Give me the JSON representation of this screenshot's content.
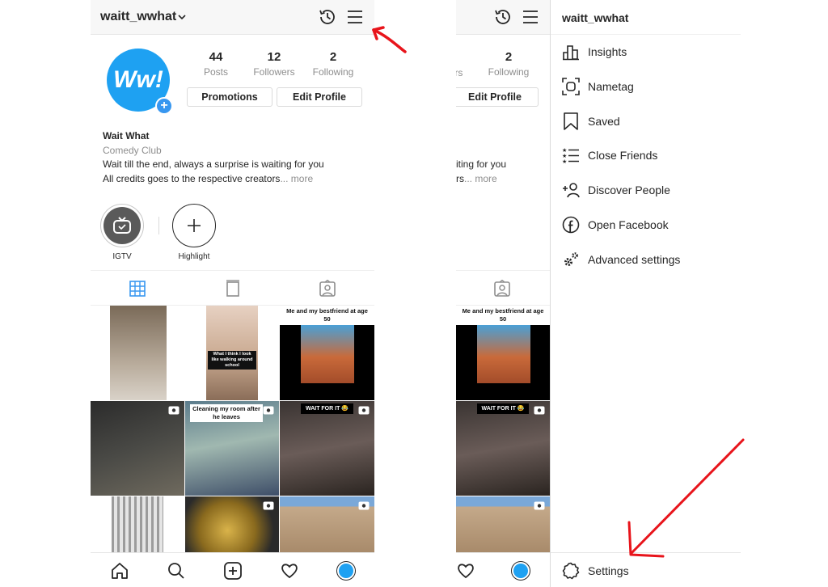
{
  "profile": {
    "username": "waitt_wwhat",
    "avatar_text": "Ww!",
    "stats": [
      {
        "num": "44",
        "label": "Posts"
      },
      {
        "num": "12",
        "label": "Followers"
      },
      {
        "num": "2",
        "label": "Following"
      }
    ],
    "buttons": {
      "promotions": "Promotions",
      "edit_profile": "Edit Profile"
    },
    "bio": {
      "name": "Wait What",
      "category": "Comedy Club",
      "line1": "Wait till the end, always a surprise is waiting for you",
      "line2": "All credits goes to the respective creators",
      "more": "... more"
    },
    "highlights": [
      {
        "label": "IGTV"
      },
      {
        "label": "Highlight"
      }
    ],
    "posts": [
      {
        "caption": ""
      },
      {
        "caption": "What I think I look like walking around school"
      },
      {
        "caption": "Me and my bestfriend at age 50"
      },
      {
        "caption": ""
      },
      {
        "caption": "Cleaning my room after he leaves"
      },
      {
        "caption": "WAIT FOR IT 😂"
      },
      {
        "caption": ""
      },
      {
        "caption": ""
      },
      {
        "caption": ""
      }
    ]
  },
  "right": {
    "stats_partial": [
      {
        "num": "",
        "label": "ers"
      },
      {
        "num": "2",
        "label": "Following"
      }
    ],
    "edit_profile": "Edit Profile",
    "bio_line1": "iting for you",
    "bio_line2_a": "rs",
    "bio_line2_more": "... more",
    "post_captions": {
      "bestfriend": "Me and my bestfriend at age 50",
      "waitforit": "WAIT FOR IT 😂"
    }
  },
  "menu": {
    "username": "waitt_wwhat",
    "items": [
      {
        "label": "Insights",
        "icon": "insights-icon"
      },
      {
        "label": "Nametag",
        "icon": "nametag-icon"
      },
      {
        "label": "Saved",
        "icon": "saved-icon"
      },
      {
        "label": "Close Friends",
        "icon": "close-friends-icon"
      },
      {
        "label": "Discover People",
        "icon": "discover-people-icon"
      },
      {
        "label": "Open Facebook",
        "icon": "facebook-icon"
      },
      {
        "label": "Advanced settings",
        "icon": "advanced-settings-icon"
      }
    ],
    "settings": "Settings"
  },
  "colors": {
    "accent_blue": "#3897f0",
    "avatar_blue": "#1ea1f2",
    "annotation_red": "#e8141b"
  }
}
